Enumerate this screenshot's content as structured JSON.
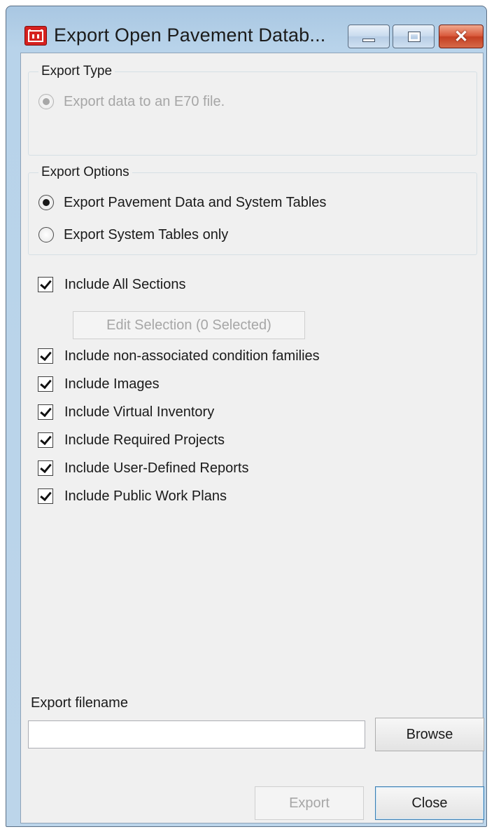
{
  "window": {
    "title": "Export Open Pavement Datab...",
    "app_icon": "usace-castle-icon",
    "controls": {
      "minimize": "minimize-icon",
      "maximize": "maximize-icon",
      "close": "✕"
    }
  },
  "export_type": {
    "legend": "Export Type",
    "options": [
      {
        "label": "Export data to an E70 file.",
        "checked": true,
        "disabled": true
      }
    ]
  },
  "export_options": {
    "legend": "Export Options",
    "options": [
      {
        "label": "Export Pavement Data and System Tables",
        "checked": true
      },
      {
        "label": "Export System Tables only",
        "checked": false
      }
    ]
  },
  "include_all_sections": {
    "label": "Include All Sections",
    "checked": true
  },
  "edit_selection_button": {
    "label": "Edit Selection (0 Selected)",
    "disabled": true
  },
  "include_options": [
    {
      "label": "Include non-associated condition families",
      "checked": true
    },
    {
      "label": "Include Images",
      "checked": true
    },
    {
      "label": "Include Virtual Inventory",
      "checked": true
    },
    {
      "label": "Include Required Projects",
      "checked": true
    },
    {
      "label": "Include User-Defined Reports",
      "checked": true
    },
    {
      "label": "Include Public Work Plans",
      "checked": true
    }
  ],
  "export_filename": {
    "label": "Export filename",
    "value": ""
  },
  "buttons": {
    "browse": "Browse",
    "export": "Export",
    "close": "Close"
  }
}
